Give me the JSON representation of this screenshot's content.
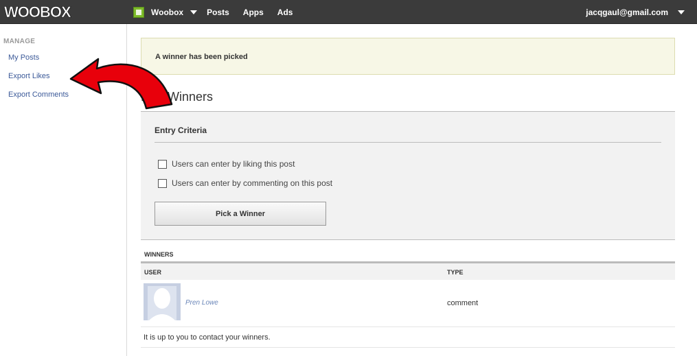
{
  "topbar": {
    "logo_text": "WOOBOX",
    "brand_label": "Woobox",
    "nav": [
      "Posts",
      "Apps",
      "Ads"
    ],
    "user_email": "jacqgaul@gmail.com"
  },
  "sidebar": {
    "heading": "MANAGE",
    "items": [
      "My Posts",
      "Export Likes",
      "Export Comments"
    ]
  },
  "notice": {
    "text": "A winner has been picked"
  },
  "page": {
    "title": "Pick Winners"
  },
  "criteria": {
    "heading": "Entry Criteria",
    "options": [
      {
        "label": "Users can enter by liking this post",
        "checked": false
      },
      {
        "label": "Users can enter by commenting on this post",
        "checked": false
      }
    ],
    "button_label": "Pick a Winner"
  },
  "winners": {
    "heading": "WINNERS",
    "columns": [
      "USER",
      "TYPE"
    ],
    "rows": [
      {
        "user": "Pren Lowe",
        "type": "comment"
      }
    ],
    "note": "It is up to you to contact your winners."
  },
  "colors": {
    "topbar": "#3b3b3b",
    "link": "#3b5998",
    "arrow": "#e8000b",
    "notice_bg": "#f7f7e6"
  }
}
